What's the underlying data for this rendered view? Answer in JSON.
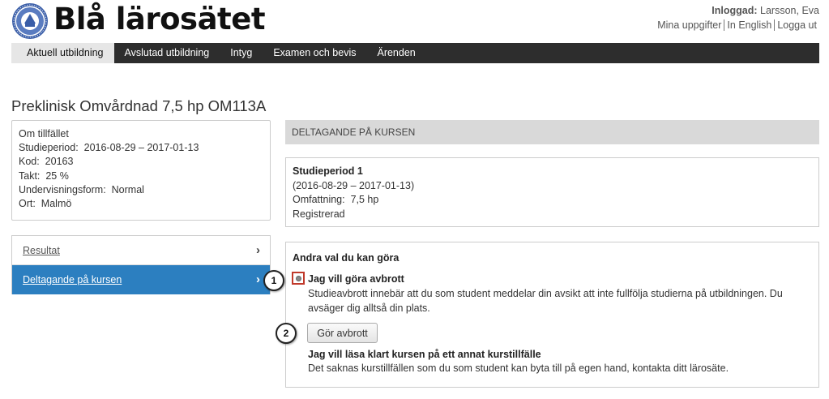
{
  "header": {
    "site_title": "Blå lärosätet",
    "logged_in_label": "Inloggad:",
    "logged_in_user": "Larsson, Eva",
    "links": [
      "Mina uppgifter",
      "In English",
      "Logga ut"
    ]
  },
  "nav": {
    "tabs": [
      {
        "label": "Aktuell utbildning",
        "active": true
      },
      {
        "label": "Avslutad utbildning",
        "active": false
      },
      {
        "label": "Intyg",
        "active": false
      },
      {
        "label": "Examen och bevis",
        "active": false
      },
      {
        "label": "Ärenden",
        "active": false
      }
    ]
  },
  "page": {
    "title": "Preklinisk Omvårdnad 7,5 hp OM113A"
  },
  "info": {
    "heading": "Om tillfället",
    "rows": [
      {
        "label": "Studieperiod:",
        "value": "2016-08-29 – 2017-01-13"
      },
      {
        "label": "Kod:",
        "value": "20163"
      },
      {
        "label": "Takt:",
        "value": "25 %"
      },
      {
        "label": "Undervisningsform:",
        "value": "Normal"
      },
      {
        "label": "Ort:",
        "value": "Malmö"
      }
    ]
  },
  "side_menu": {
    "items": [
      {
        "label": "Resultat",
        "active": false
      },
      {
        "label": "Deltagande på kursen",
        "active": true
      }
    ],
    "chevron": "›"
  },
  "section": {
    "header": "DELTAGANDE PÅ KURSEN"
  },
  "period": {
    "title": "Studieperiod 1",
    "dates": "(2016-08-29 – 2017-01-13)",
    "scope_label": "Omfattning:",
    "scope_value": "7,5 hp",
    "status": "Registrerad"
  },
  "choices": {
    "title": "Andra val du kan göra",
    "option1_title": "Jag vill göra avbrott",
    "option1_desc": "Studieavbrott innebär att du som student meddelar din avsikt att inte fullfölja studierna på utbildningen. Du avsäger dig alltså din plats.",
    "abort_button": "Gör avbrott",
    "option2_title": "Jag vill läsa klart kursen på ett annat kurstillfälle",
    "option2_desc": "Det saknas kurstillfällen som du som student kan byta till på egen hand, kontakta ditt lärosäte."
  },
  "callouts": [
    "1",
    "2"
  ],
  "colors": {
    "nav_bg": "#2d2d2d",
    "active_side": "#2c7fc0",
    "section_header_bg": "#d9d9d9",
    "highlight_red": "#c0392b"
  }
}
